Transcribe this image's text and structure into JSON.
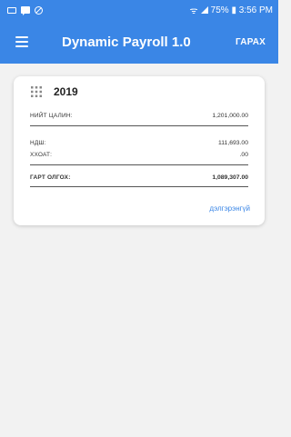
{
  "status_bar": {
    "right_text": "75% ▮ 3:56 PM"
  },
  "app_bar": {
    "title": "Dynamic Payroll 1.0",
    "logout_label": "ГАРАХ"
  },
  "card": {
    "year": "2019",
    "rows": [
      {
        "label": "НИЙТ ЦАЛИН:",
        "value": "1,201,000.00"
      },
      {
        "label": "НДШ:",
        "value": "111,693.00"
      },
      {
        "label": "ХХОАТ:",
        "value": ".00"
      },
      {
        "label": "ГАРТ ОЛГОХ:",
        "value": "1,089,307.00"
      }
    ],
    "details_label": "дэлгэрэнгүй"
  },
  "colors": {
    "primary": "#3a86e6",
    "background": "#f2f2f2",
    "card": "#ffffff"
  }
}
